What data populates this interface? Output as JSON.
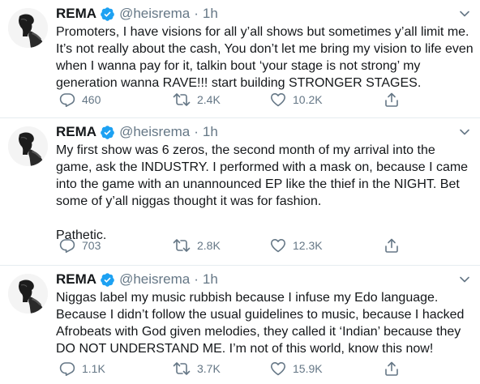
{
  "tweets": [
    {
      "author": {
        "name": "REMA",
        "handle": "@heisrema",
        "separator": "·",
        "time": "1h",
        "verified": true
      },
      "text": "Promoters, I have visions for all y’all shows but sometimes y’all limit me. It’s not really about the cash, You don’t let me bring my vision to life even when I wanna pay for it, talkin bout ‘your stage is not strong’ my generation wanna RAVE!!! start building STRONGER STAGES.",
      "stats": {
        "replies": "460",
        "retweets": "2.4K",
        "likes": "10.2K"
      }
    },
    {
      "author": {
        "name": "REMA",
        "handle": "@heisrema",
        "separator": "·",
        "time": "1h",
        "verified": true
      },
      "text": "My first show was 6 zeros, the second month of my arrival into the game, ask the INDUSTRY. I performed with a mask on, because I came into the game with an unannounced EP like the thief in the NIGHT. Bet some of y’all niggas thought it was for fashion.\n\nPathetic.",
      "stats": {
        "replies": "703",
        "retweets": "2.8K",
        "likes": "12.3K"
      }
    },
    {
      "author": {
        "name": "REMA",
        "handle": "@heisrema",
        "separator": "·",
        "time": "1h",
        "verified": true
      },
      "text": "Niggas label my music rubbish because I infuse my Edo language. Because I didn’t follow the usual guidelines to music, because I hacked Afrobeats with God given melodies, they called it ‘Indian’ because they DO NOT UNDERSTAND ME. I’m not of this world, know this now!",
      "stats": {
        "replies": "1.1K",
        "retweets": "3.7K",
        "likes": "15.9K"
      }
    }
  ],
  "colors": {
    "text": "#14171a",
    "muted": "#657786",
    "verified": "#1da1f2",
    "divider": "#e6ecf0"
  },
  "icons": [
    "avatar-photo",
    "verified-badge-icon",
    "chevron-down-icon",
    "reply-icon",
    "retweet-icon",
    "like-icon",
    "share-icon"
  ]
}
